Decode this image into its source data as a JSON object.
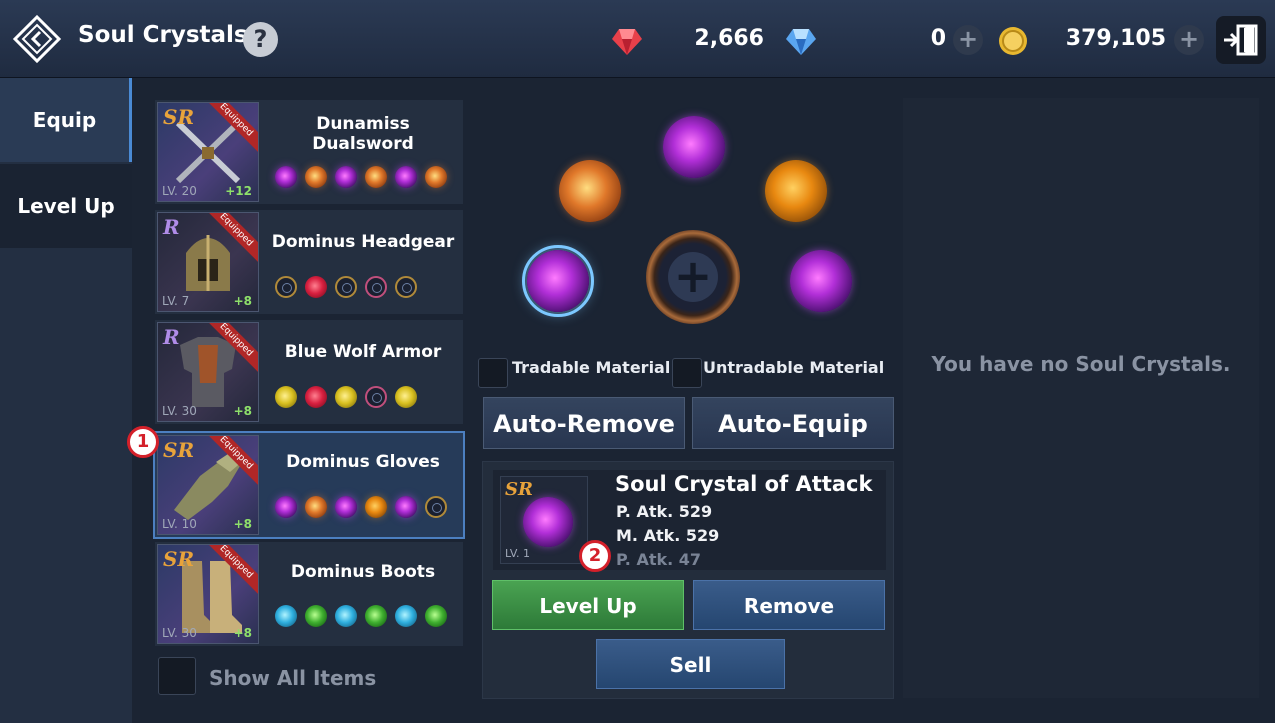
{
  "header": {
    "title": "Soul Crystals",
    "help_label": "?",
    "back_icon": "back-diamond-icon",
    "exit_icon": "exit-door-icon"
  },
  "currencies": [
    {
      "name": "red-gem",
      "value": "2,666",
      "color": "#e8404a"
    },
    {
      "name": "blue-diamond",
      "value": "0",
      "color": "#5aa6f0"
    },
    {
      "name": "gold-coin",
      "value": "379,105",
      "color": "#e8b830"
    }
  ],
  "sidebar": {
    "tabs": [
      {
        "label": "Equip",
        "active": true
      },
      {
        "label": "Level Up",
        "active": false
      }
    ]
  },
  "items": [
    {
      "name": "Dunamiss Dualsword",
      "grade": "SR",
      "level": "LV. 20",
      "plus": "+12",
      "equipped": "Equipped",
      "slots": [
        "purple",
        "orange",
        "purple",
        "orange",
        "purple",
        "orange"
      ]
    },
    {
      "name": "Dominus Headgear",
      "grade": "R",
      "level": "LV. 7",
      "plus": "+8",
      "equipped": "Equipped",
      "slots": [
        "empty",
        "red",
        "empty",
        "empty-pink",
        "empty"
      ]
    },
    {
      "name": "Blue Wolf Armor",
      "grade": "R",
      "level": "LV. 30",
      "plus": "+8",
      "equipped": "Equipped",
      "slots": [
        "yellow",
        "red",
        "yellow",
        "empty-pink",
        "yellow"
      ]
    },
    {
      "name": "Dominus Gloves",
      "grade": "SR",
      "level": "LV. 10",
      "plus": "+8",
      "equipped": "Equipped",
      "slots": [
        "purple",
        "orange",
        "purple",
        "orange",
        "purple",
        "empty"
      ]
    },
    {
      "name": "Dominus Boots",
      "grade": "SR",
      "level": "LV. 30",
      "plus": "+8",
      "equipped": "Equipped",
      "slots": [
        "cyan",
        "green",
        "cyan",
        "green",
        "cyan",
        "green"
      ]
    }
  ],
  "show_all": {
    "label": "Show All Items",
    "checked": false
  },
  "materials": {
    "tradable_label": "Tradable Material",
    "untradable_label": "Untradable Material"
  },
  "buttons": {
    "auto_remove": "Auto-Remove",
    "auto_equip": "Auto-Equip",
    "level_up": "Level Up",
    "remove": "Remove",
    "sell": "Sell"
  },
  "selected_crystal": {
    "grade": "SR",
    "name": "Soul Crystal of Attack",
    "level": "LV. 1",
    "stats": [
      "P. Atk. 529",
      "M. Atk. 529",
      "P. Atk. 47"
    ]
  },
  "right_panel": {
    "empty_message": "You have no Soul Crystals."
  },
  "markers": [
    "1",
    "2"
  ]
}
